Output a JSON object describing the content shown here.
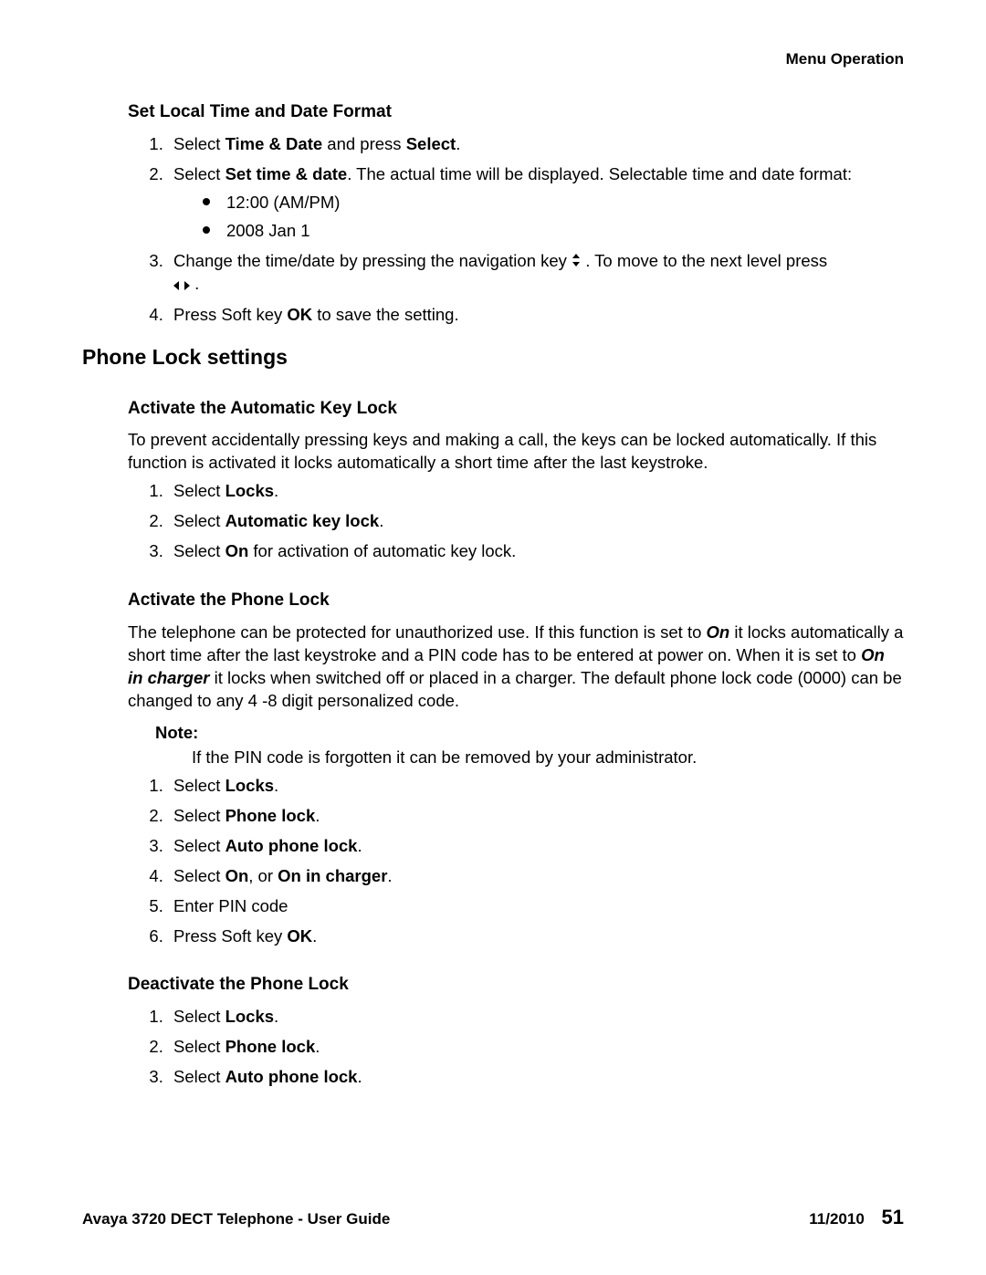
{
  "header": {
    "section": "Menu Operation"
  },
  "s1": {
    "title": "Set Local Time and Date Format",
    "li1_a": "Select ",
    "li1_b": "Time & Date",
    "li1_c": " and press ",
    "li1_d": "Select",
    "li1_e": ".",
    "li2_a": "Select ",
    "li2_b": "Set time & date",
    "li2_c": ". The actual time will be displayed. Selectable time and date format:",
    "bul1": "12:00 (AM/PM)",
    "bul2": "2008 Jan 1",
    "li3_a": "Change the time/date by pressing the navigation key ",
    "li3_b": " . To move to the next level press ",
    "li3_c": " .",
    "li4_a": "Press Soft key ",
    "li4_b": "OK",
    "li4_c": " to save the setting."
  },
  "s2": {
    "title": "Phone Lock settings"
  },
  "s2a": {
    "title": "Activate the Automatic Key Lock",
    "para": "To prevent accidentally pressing keys and making a call, the keys can be locked automatically. If this function is activated it locks automatically a short time after the last keystroke.",
    "li1_a": "Select ",
    "li1_b": "Locks",
    "li1_c": ".",
    "li2_a": "Select ",
    "li2_b": "Automatic key lock",
    "li2_c": ".",
    "li3_a": "Select ",
    "li3_b": "On",
    "li3_c": " for activation of automatic key lock."
  },
  "s2b": {
    "title": "Activate the Phone Lock",
    "p_a": "The telephone can be protected for unauthorized use. If this function is set to ",
    "p_b": "On",
    "p_c": " it locks automatically a short time after the last keystroke and a PIN code has to be entered at power on. When it is set to ",
    "p_d": "On in charger",
    "p_e": " it locks when switched off or placed in a charger. The default phone lock code (0000) can be changed to any 4 -8 digit personalized code.",
    "note_label": "Note:",
    "note_text": "If the PIN code is forgotten it can be removed by your administrator.",
    "li1_a": "Select ",
    "li1_b": "Locks",
    "li1_c": ".",
    "li2_a": "Select ",
    "li2_b": "Phone lock",
    "li2_c": ".",
    "li3_a": "Select ",
    "li3_b": "Auto phone lock",
    "li3_c": ".",
    "li4_a": "Select ",
    "li4_b": "On",
    "li4_c": ", or ",
    "li4_d": "On in charger",
    "li4_e": ".",
    "li5": "Enter PIN code",
    "li6_a": "Press Soft key ",
    "li6_b": "OK",
    "li6_c": "."
  },
  "s2c": {
    "title": "Deactivate the Phone Lock",
    "li1_a": "Select ",
    "li1_b": "Locks",
    "li1_c": ".",
    "li2_a": "Select ",
    "li2_b": "Phone lock",
    "li2_c": ".",
    "li3_a": "Select ",
    "li3_b": "Auto phone lock",
    "li3_c": "."
  },
  "footer": {
    "left": "Avaya 3720 DECT Telephone - User Guide",
    "date": "11/2010",
    "page": "51"
  }
}
